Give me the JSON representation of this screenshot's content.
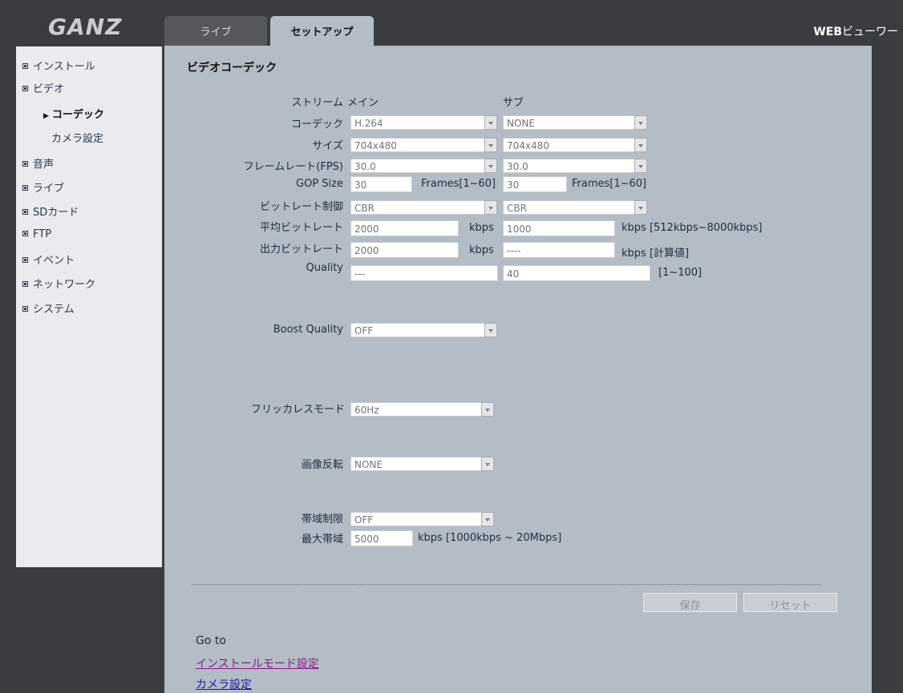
{
  "header": {
    "logo_text": "GANZ",
    "tabs": [
      {
        "label": "ライブ"
      },
      {
        "label": "セットアップ"
      }
    ],
    "title_bold": "WEB",
    "title_rest": "ビューワー"
  },
  "sidebar": {
    "items": [
      {
        "label": "インストール"
      },
      {
        "label": "ビデオ"
      },
      {
        "label": "音声"
      },
      {
        "label": "ライブ"
      },
      {
        "label": "SDカード"
      },
      {
        "label": "FTP"
      },
      {
        "label": "イベント"
      },
      {
        "label": "ネットワーク"
      },
      {
        "label": "システム"
      }
    ],
    "video_sub": [
      {
        "label": "コーデック"
      },
      {
        "label": "カメラ設定"
      }
    ]
  },
  "main": {
    "title": "ビデオコーデック",
    "stream_label": "ストリーム",
    "main_header": "メイン",
    "sub_header": "サブ",
    "codec_label": "コーデック",
    "codec_main": "H.264",
    "codec_sub": "NONE",
    "size_label": "サイズ",
    "size_main": "704x480",
    "size_sub": "704x480",
    "fps_label": "フレームレート(FPS)",
    "fps_main": "30.0",
    "fps_sub": "30.0",
    "gop_label": "GOP Size",
    "gop_main": "30",
    "gop_sub": "30",
    "gop_unit": "Frames[1~60]",
    "brc_label": "ビットレート制御",
    "brc_main": "CBR",
    "brc_sub": "CBR",
    "avg_label": "平均ビットレート",
    "avg_main": "2000",
    "avg_sub": "1000",
    "kbps": "kbps",
    "avg_unit_sub": "kbps [512kbps~8000kbps]",
    "out_label": "出力ビットレート",
    "out_main": "2000",
    "out_sub": "----",
    "out_unit_sub": "kbps [計算値]",
    "quality_label": "Quality",
    "quality_main": "---",
    "quality_sub": "40",
    "quality_unit": "[1~100]",
    "boost_label": "Boost Quality",
    "boost_value": "OFF",
    "flicker_label": "フリッカレスモード",
    "flicker_value": "60Hz",
    "flip_label": "画像反転",
    "flip_value": "NONE",
    "bw_label": "帯域制限",
    "bw_value": "OFF",
    "maxbw_label": "最大帯域",
    "maxbw_value": "5000",
    "maxbw_unit": "kbps [1000kbps ~ 20Mbps]"
  },
  "buttons": {
    "save": "保存",
    "reset": "リセット"
  },
  "footer": {
    "goto": "Go to",
    "link_install": "インストールモード設定",
    "link_camera": "カメラ設定"
  },
  "colors": {
    "link_visited": "#8b1a8b",
    "link": "#1a1aa6"
  }
}
